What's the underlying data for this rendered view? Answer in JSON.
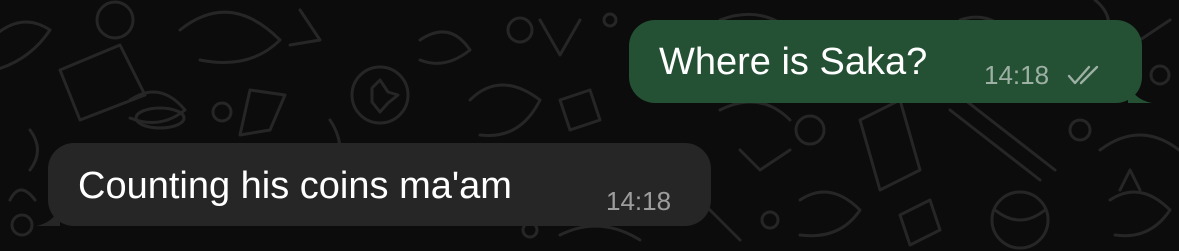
{
  "conversation": {
    "messages": [
      {
        "direction": "outgoing",
        "text": "Where is Saka?",
        "time": "14:18",
        "status_icon": "double-check-icon",
        "bubble_color": "#245034"
      },
      {
        "direction": "incoming",
        "text": "Counting his coins ma'am",
        "time": "14:18",
        "bubble_color": "#262626"
      }
    ]
  },
  "theme": {
    "background": "#0c0c0c",
    "doodle_color": "#2a2a2a",
    "text_color": "#ffffff",
    "meta_color": "#9a9a9a"
  }
}
